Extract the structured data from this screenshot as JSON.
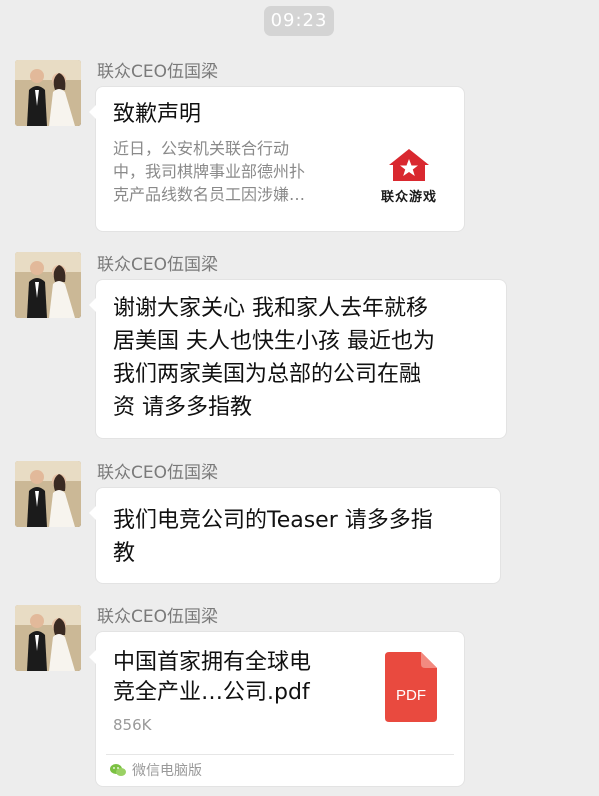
{
  "status": {
    "time": "09:23"
  },
  "messages": [
    {
      "sender": "联众CEO伍国梁",
      "type": "link",
      "title": "致歉声明",
      "desc_lines": [
        "近日，公安机关联合行动",
        "中，我司棋牌事业部德州扑",
        "克产品线数名员工因涉嫌…"
      ],
      "thumb_label": "联众游戏"
    },
    {
      "sender": "联众CEO伍国梁",
      "type": "text",
      "lines": [
        "谢谢大家关心 我和家人去年就移",
        "居美国 夫人也快生小孩 最近也为",
        "我们两家美国为总部的公司在融",
        "资 请多多指教"
      ]
    },
    {
      "sender": "联众CEO伍国梁",
      "type": "text",
      "lines": [
        "我们电竞公司的Teaser 请多多指",
        "教"
      ]
    },
    {
      "sender": "联众CEO伍国梁",
      "type": "file",
      "name_lines": [
        "中国首家拥有全球电",
        "竞全产业…公司.pdf"
      ],
      "size": "856K",
      "icon_label": "PDF",
      "source": "微信电脑版"
    }
  ],
  "colors": {
    "background": "#ededed",
    "bubble": "#ffffff",
    "pdf_red": "#e94a3f",
    "thumb_red": "#d9282f",
    "wechat_green": "#7bc142"
  },
  "icons": {
    "thumb": "lianzhong-game-logo-icon",
    "file": "pdf-file-icon",
    "source": "wechat-icon"
  }
}
